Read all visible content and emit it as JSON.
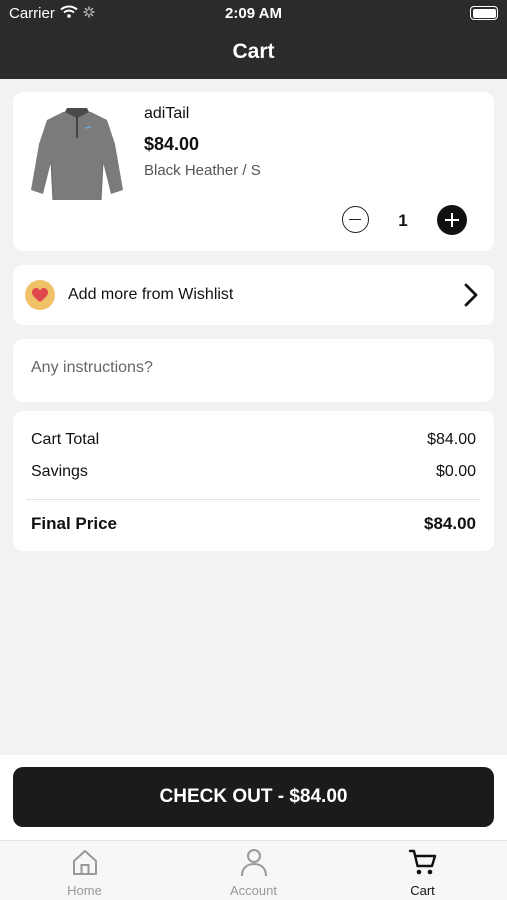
{
  "status_bar": {
    "carrier": "Carrier",
    "time": "2:09 AM"
  },
  "nav": {
    "title": "Cart"
  },
  "cart_item": {
    "brand": "adiTail",
    "price": "$84.00",
    "variant": "Black Heather / S",
    "quantity": "1"
  },
  "wishlist": {
    "label": "Add more from Wishlist"
  },
  "instructions": {
    "placeholder": "Any instructions?"
  },
  "summary": {
    "cart_total_label": "Cart Total",
    "cart_total_value": "$84.00",
    "savings_label": "Savings",
    "savings_value": "$0.00",
    "final_price_label": "Final Price",
    "final_price_value": "$84.00"
  },
  "checkout": {
    "label": "CHECK OUT - $84.00"
  },
  "tabs": [
    {
      "label": "Home",
      "icon": "home-icon"
    },
    {
      "label": "Account",
      "icon": "person-icon"
    },
    {
      "label": "Cart",
      "icon": "cart-icon"
    }
  ],
  "colors": {
    "header": "#2b2b2b",
    "checkout_button": "#1b1b1b",
    "heart_badge": "#f0c267",
    "heart": "#e0474c"
  }
}
